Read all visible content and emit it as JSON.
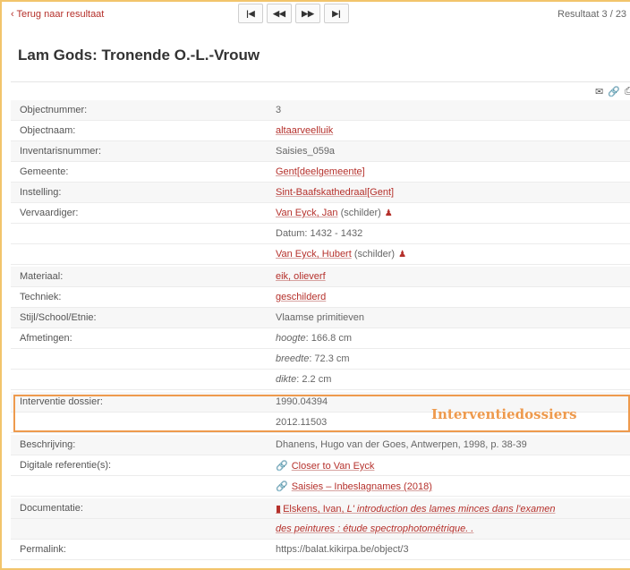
{
  "nav": {
    "back_label": "‹ Terug naar resultaat",
    "first_label": "|◀",
    "prev_label": "◀◀",
    "next_label": "▶▶",
    "last_label": "▶|",
    "result_count": "Resultaat 3 / 23"
  },
  "title": "Lam Gods: Tronende O.-L.-Vrouw",
  "actions": {
    "mail_icon": "✉",
    "link_icon": "🔗",
    "print_icon": "⎙"
  },
  "fields": {
    "objectnummer": {
      "label": "Objectnummer:",
      "value": "3"
    },
    "objectnaam": {
      "label": "Objectnaam:",
      "value": "altaarveelluik"
    },
    "inventarisnummer": {
      "label": "Inventarisnummer:",
      "value": "Saisies_059a"
    },
    "gemeente": {
      "label": "Gemeente:",
      "value": "Gent[deelgemeente]"
    },
    "instelling": {
      "label": "Instelling:",
      "value": "Sint-Baafskathedraal[Gent]"
    },
    "vervaardiger": {
      "label": "Vervaardiger:",
      "maker1_name": "Van Eyck, Jan",
      "maker1_role": "(schilder)",
      "datum": "Datum: 1432 - 1432",
      "maker2_name": "Van Eyck, Hubert",
      "maker2_role": "(schilder)"
    },
    "materiaal": {
      "label": "Materiaal:",
      "value": "eik, olieverf"
    },
    "techniek": {
      "label": "Techniek:",
      "value": "geschilderd"
    },
    "stijl": {
      "label": "Stijl/School/Etnie:",
      "value": "Vlaamse primitieven"
    },
    "afmetingen": {
      "label": "Afmetingen:",
      "hoogte_key": "hoogte",
      "hoogte_val": ": 166.8 cm",
      "breedte_key": "breedte",
      "breedte_val": ": 72.3 cm",
      "dikte_key": "dikte",
      "dikte_val": ": 2.2 cm"
    },
    "interventie": {
      "label": "Interventie dossier:",
      "value1": "1990.04394",
      "value2": "2012.11503"
    },
    "beschrijving": {
      "label": "Beschrijving:",
      "value": "Dhanens, Hugo van der Goes, Antwerpen, 1998, p. 38-39"
    },
    "digitale": {
      "label": "Digitale referentie(s):",
      "value1": "Closer to Van Eyck",
      "value2": "Saisies – Inbeslagnames (2018)"
    },
    "documentatie": {
      "label": "Documentatie:",
      "author": "Elskens, Ivan, ",
      "title_line1": "L' introduction des lames minces dans l'examen",
      "title_line2": "des peintures : étude spectrophotométrique. ."
    },
    "permalink": {
      "label": "Permalink:",
      "value": "https://balat.kikirpa.be/object/3"
    }
  },
  "annotation": {
    "label": "Interventiedossiers",
    "color": "#ee9a4d"
  }
}
